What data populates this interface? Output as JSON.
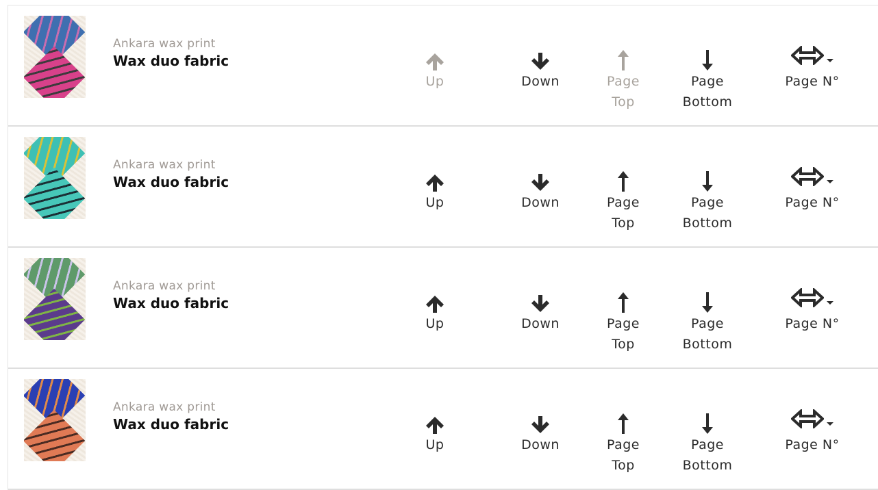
{
  "rows": [
    {
      "category": "Ankara wax print",
      "title": "Wax duo fabric",
      "thumb_icon": "wax-fabric-blue-pink",
      "colors": {
        "top": "#3f6fb0",
        "top_accent": "#c76db0",
        "bottom": "#d8418a",
        "bottom_accent": "#3d3a3c"
      },
      "up_disabled": true,
      "top_disabled": true
    },
    {
      "category": "Ankara wax print",
      "title": "Wax duo fabric",
      "thumb_icon": "wax-fabric-turquoise",
      "colors": {
        "top": "#3ec0b4",
        "top_accent": "#d7c23a",
        "bottom": "#47c7b9",
        "bottom_accent": "#1b2f35"
      },
      "up_disabled": false,
      "top_disabled": false
    },
    {
      "category": "Ankara wax print",
      "title": "Wax duo fabric",
      "thumb_icon": "wax-fabric-green-purple",
      "colors": {
        "top": "#5f9a6a",
        "top_accent": "#c9c4e8",
        "bottom": "#5b3b8c",
        "bottom_accent": "#7fb545"
      },
      "up_disabled": false,
      "top_disabled": false
    },
    {
      "category": "Ankara wax print",
      "title": "Wax duo fabric",
      "thumb_icon": "wax-fabric-blue-orange",
      "colors": {
        "top": "#2a3fb3",
        "top_accent": "#e08a4a",
        "bottom": "#e07a55",
        "bottom_accent": "#4a2b22"
      },
      "up_disabled": false,
      "top_disabled": false
    }
  ],
  "labels": {
    "up": "Up",
    "down": "Down",
    "page_top": "Page\nTop",
    "page_bottom": "Page\nBottom",
    "page_no": "Page N°"
  },
  "icons": {
    "up": "arrow-up-icon",
    "down": "arrow-down-icon",
    "page_top": "thin-arrow-up-icon",
    "page_bottom": "thin-arrow-down-icon",
    "page_no": "double-arrow-horizontal-icon"
  },
  "colors": {
    "active": "#2b2b2b",
    "disabled": "#a8a39d",
    "subtitle": "#a09a95"
  }
}
